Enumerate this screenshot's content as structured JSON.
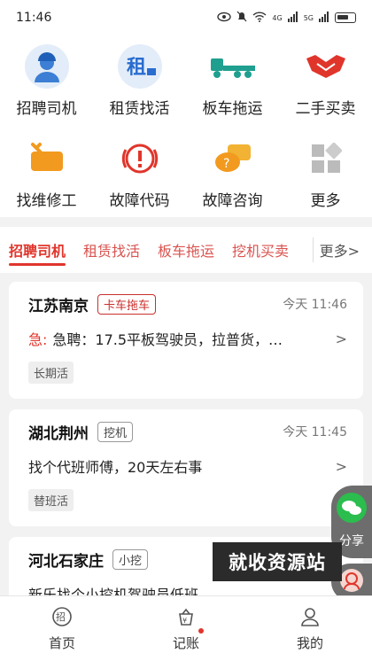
{
  "status_bar": {
    "time": "11:46",
    "net1": "4G",
    "net2": "5G"
  },
  "grid": [
    {
      "label": "招聘司机",
      "icon": "driver-avatar-icon"
    },
    {
      "label": "租赁找活",
      "icon": "rental-icon",
      "icon_text": "租"
    },
    {
      "label": "板车拖运",
      "icon": "flatbed-truck-icon"
    },
    {
      "label": "二手买卖",
      "icon": "handshake-icon"
    },
    {
      "label": "找维修工",
      "icon": "repair-icon"
    },
    {
      "label": "故障代码",
      "icon": "fault-code-icon"
    },
    {
      "label": "故障咨询",
      "icon": "consult-icon"
    },
    {
      "label": "更多",
      "icon": "more-grid-icon"
    }
  ],
  "tabs": [
    "招聘司机",
    "租赁找活",
    "板车拖运",
    "挖机买卖"
  ],
  "tabs_more": "更多>",
  "jobs": [
    {
      "city": "江苏南京",
      "tag": "卡车拖车",
      "time": "今天 11:46",
      "urgent": "急:",
      "text": "急聘：17.5平板驾驶员，拉普货，…",
      "pill": "长期活"
    },
    {
      "city": "湖北荆州",
      "tag": "挖机",
      "time": "今天 11:45",
      "text": "找个代班师傅，20天左右事",
      "pill": "替班活"
    },
    {
      "city": "河北石家庄",
      "tag": "小挖",
      "text": "新乐找个小挖机驾驶员低班"
    }
  ],
  "share_label": "分享",
  "watermark": "就收资源站",
  "nav": [
    {
      "label": "首页",
      "icon": "home-icon",
      "glyph": "招"
    },
    {
      "label": "记账",
      "icon": "ledger-icon",
      "glyph": "¥"
    },
    {
      "label": "我的",
      "icon": "profile-icon"
    }
  ],
  "colors": {
    "accent": "#e0352b",
    "tab_text": "#d9534f",
    "share_bg": "#6d6d6d"
  }
}
